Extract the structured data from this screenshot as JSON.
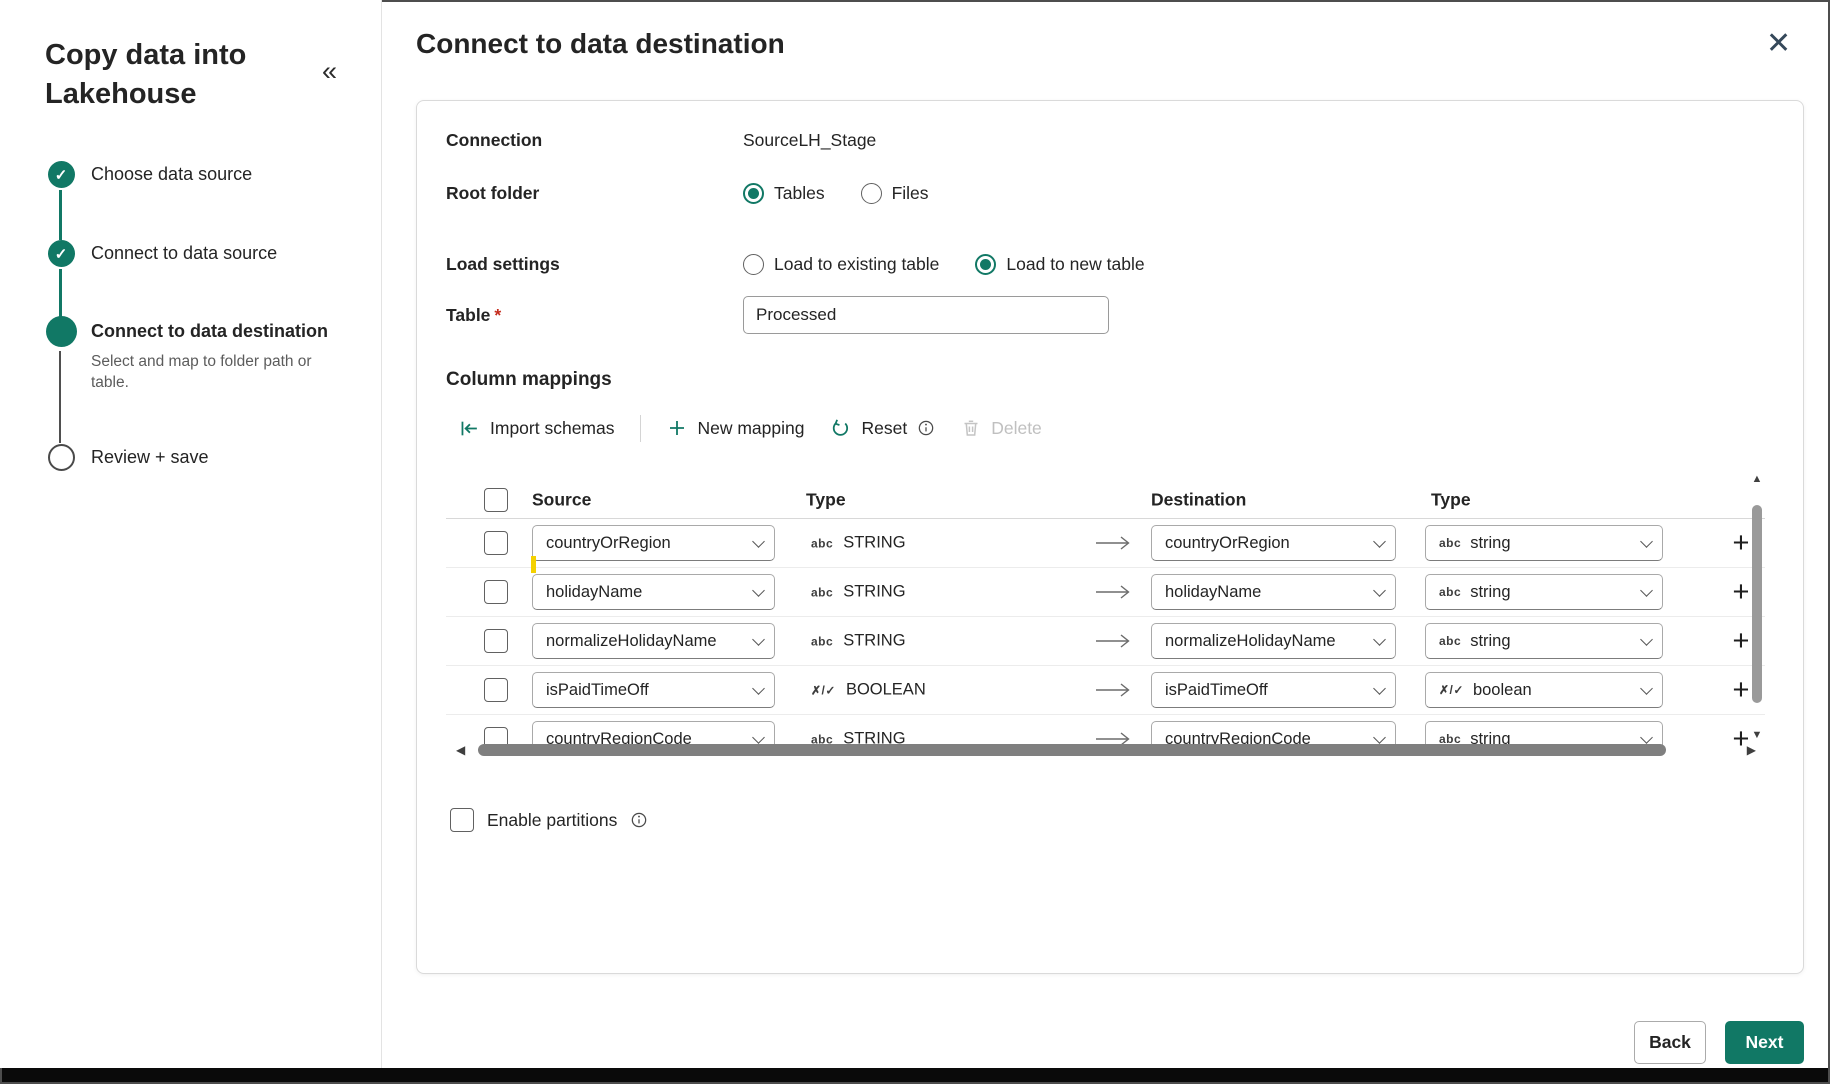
{
  "glyphs": {
    "check": "✓",
    "collapse": "«",
    "close": "✕",
    "plus": "+",
    "scroll_up": "▲",
    "scroll_down": "▼",
    "scroll_left": "◀",
    "scroll_right": "▶"
  },
  "colors": {
    "accent": "#117865",
    "required": "#c42b1c"
  },
  "sidebar": {
    "title": "Copy data into Lakehouse",
    "steps": [
      {
        "label": "Choose data source",
        "state": "complete"
      },
      {
        "label": "Connect to data source",
        "state": "complete"
      },
      {
        "label": "Connect to data destination",
        "state": "active",
        "description": "Select and map to folder path or table."
      },
      {
        "label": "Review + save",
        "state": "pending"
      }
    ]
  },
  "header": {
    "title": "Connect to data destination"
  },
  "form": {
    "connection": {
      "label": "Connection",
      "value": "SourceLH_Stage"
    },
    "root_folder": {
      "label": "Root folder",
      "options": [
        "Tables",
        "Files"
      ],
      "selected": "Tables"
    },
    "load_settings": {
      "label": "Load settings",
      "options": [
        "Load to existing table",
        "Load to new table"
      ],
      "selected": "Load to new table"
    },
    "table": {
      "label": "Table",
      "required_mark": "*",
      "value": "Processed"
    }
  },
  "mappings": {
    "heading": "Column mappings",
    "toolbar": {
      "import": "Import schemas",
      "new": "New mapping",
      "reset": "Reset",
      "delete": "Delete"
    },
    "columns": {
      "source": "Source",
      "source_type": "Type",
      "destination": "Destination",
      "destination_type": "Type"
    },
    "icon_glyphs": {
      "abc-icon": "abc",
      "boolean-icon": "✗/✓"
    },
    "rows": [
      {
        "source": "countryOrRegion",
        "source_type": "STRING",
        "destination": "countryOrRegion",
        "destination_type": "string",
        "icon": "abc-icon"
      },
      {
        "source": "holidayName",
        "source_type": "STRING",
        "destination": "holidayName",
        "destination_type": "string",
        "icon": "abc-icon"
      },
      {
        "source": "normalizeHolidayName",
        "source_type": "STRING",
        "destination": "normalizeHolidayName",
        "destination_type": "string",
        "icon": "abc-icon"
      },
      {
        "source": "isPaidTimeOff",
        "source_type": "BOOLEAN",
        "destination": "isPaidTimeOff",
        "destination_type": "boolean",
        "icon": "boolean-icon"
      },
      {
        "source": "countryRegionCode",
        "source_type": "STRING",
        "destination": "countryRegionCode",
        "destination_type": "string",
        "icon": "abc-icon"
      }
    ],
    "enable_partitions": "Enable partitions"
  },
  "footer": {
    "back": "Back",
    "next": "Next"
  }
}
